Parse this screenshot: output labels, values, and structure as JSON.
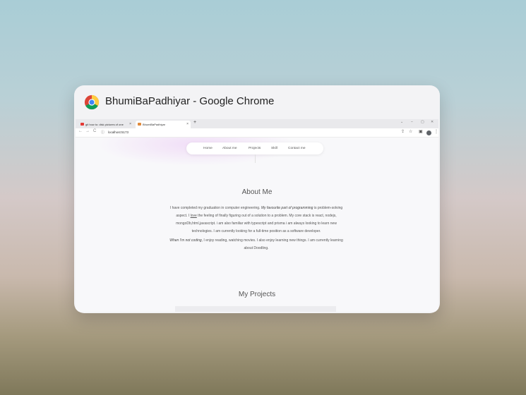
{
  "window": {
    "title": "BhumiBaPadhiyar - Google Chrome"
  },
  "tabs": [
    {
      "label": "git how to: disk pictures of one",
      "favicon": "youtube-icon",
      "color": "#e53935",
      "close": "×"
    },
    {
      "label": "BhumiBaPadhiyar",
      "favicon": "site-icon",
      "color": "#e08a3c",
      "close": "×"
    }
  ],
  "new_tab": "+",
  "window_controls": {
    "minimize": "–",
    "restore": "▢",
    "close": "✕",
    "dropdown": "⌄"
  },
  "toolbar": {
    "back": "←",
    "forward": "→",
    "reload": "C",
    "site_info": "ⓘ",
    "url": "localhost:5173"
  },
  "site": {
    "nav": [
      "Home",
      "About me",
      "Projects",
      "Skill",
      "Contact me"
    ],
    "about": {
      "heading": "About Me",
      "p1_a": "I have completed my graduation in computer engineering. ",
      "p1_em": "My favourite part of programming",
      "p1_b": " is problem-solving aspect. I ",
      "p1_u": "love",
      "p1_c": " the feeling of finally figuring out of a solution to a problem. My core stack is react, nodejs, mongoDb,html,javascript. i am also familiar with typescript and prisma i am always looking to learn new technologies. I am currently looking for a full-time position as a software developer.",
      "p2_em": "When I'm not coding",
      "p2_b": ", I enjoy reading, watching movies. I also enjoy learning new things. I am currently learning about Doodling."
    },
    "projects": {
      "heading": "My Projects"
    }
  }
}
